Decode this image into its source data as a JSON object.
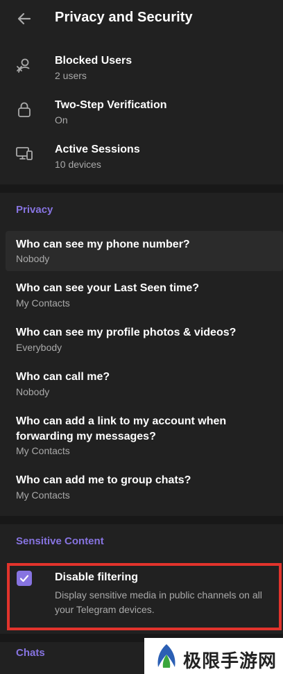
{
  "header": {
    "title": "Privacy and Security",
    "back_icon": "arrow-left-icon"
  },
  "security_items": [
    {
      "icon": "blocked-user-icon",
      "title": "Blocked Users",
      "subtitle": "2 users"
    },
    {
      "icon": "lock-icon",
      "title": "Two-Step Verification",
      "subtitle": "On"
    },
    {
      "icon": "devices-icon",
      "title": "Active Sessions",
      "subtitle": "10 devices"
    }
  ],
  "privacy": {
    "header": "Privacy",
    "items": [
      {
        "title": "Who can see my phone number?",
        "value": "Nobody"
      },
      {
        "title": "Who can see your Last Seen time?",
        "value": "My Contacts"
      },
      {
        "title": "Who can see my profile photos & videos?",
        "value": "Everybody"
      },
      {
        "title": "Who can call me?",
        "value": "Nobody"
      },
      {
        "title": "Who can add a link to my account when forwarding my messages?",
        "value": "My Contacts"
      },
      {
        "title": "Who can add me to group chats?",
        "value": "My Contacts"
      }
    ]
  },
  "sensitive": {
    "header": "Sensitive Content",
    "checkbox_label": "Disable filtering",
    "checkbox_checked": true,
    "description": "Display sensitive media in public channels on all your Telegram devices."
  },
  "chats": {
    "header": "Chats"
  },
  "watermark": {
    "text": "极限手游网"
  },
  "colors": {
    "accent": "#8774e1",
    "background": "#212121",
    "divider": "#181818",
    "secondary_text": "#aaaaaa",
    "highlight": "#e2332c"
  }
}
